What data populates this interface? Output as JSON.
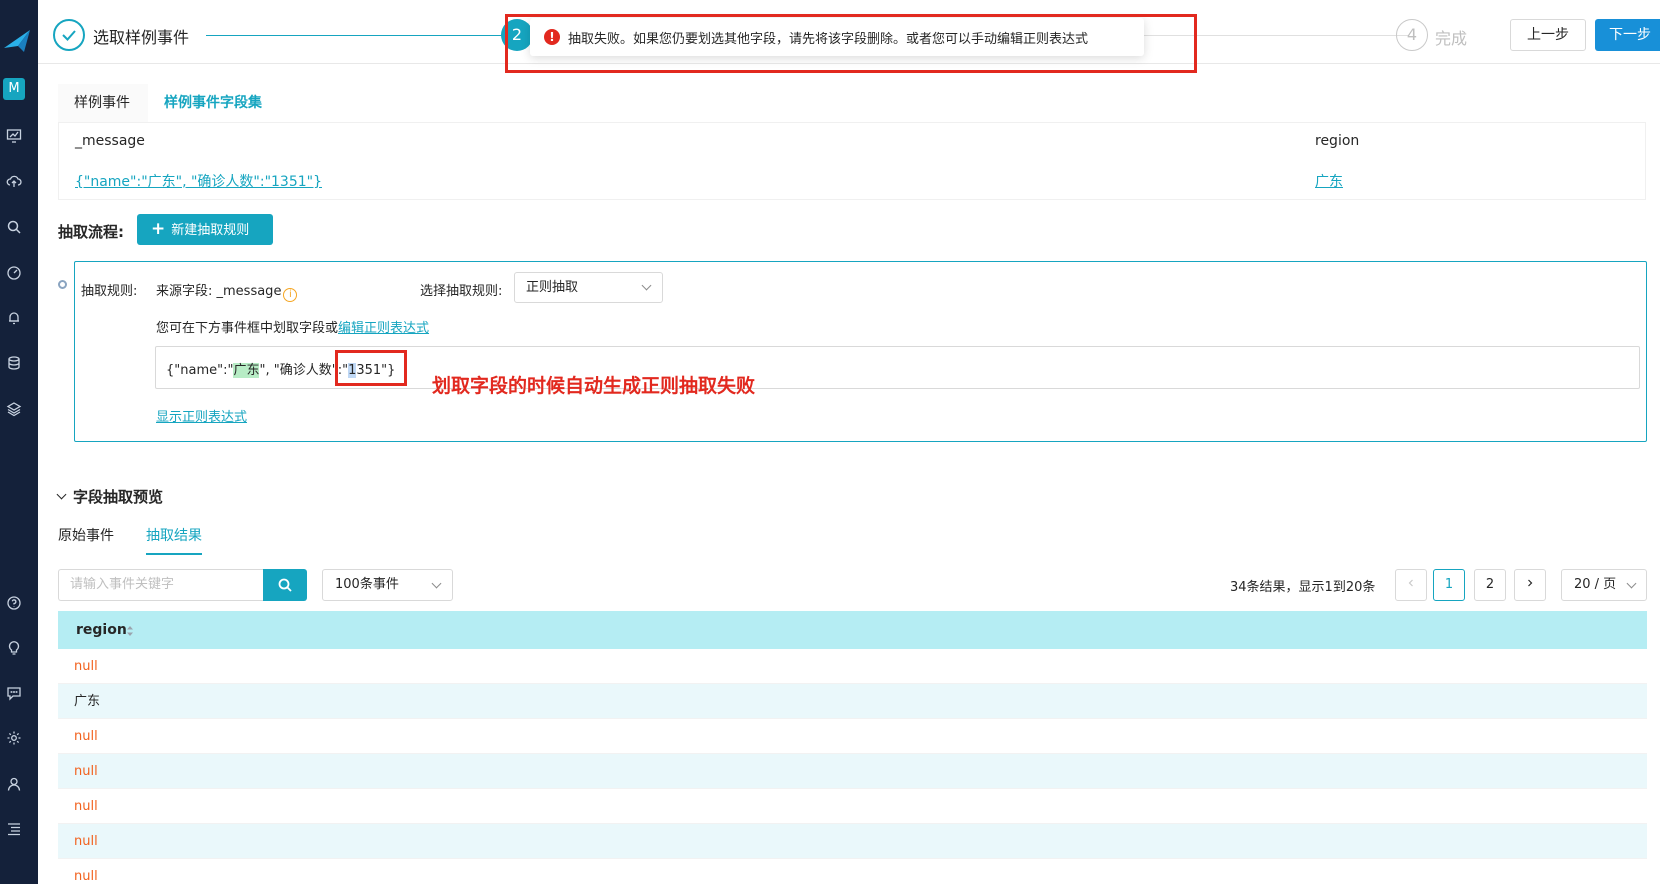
{
  "sidebar": {
    "avatar_letter": "M",
    "icons": [
      "dashboard-icon",
      "upload-cloud-icon",
      "search-icon",
      "gauge-icon",
      "bell-icon",
      "storage-icon",
      "layers-icon",
      "help-icon",
      "bulb-icon",
      "chat-icon",
      "gear-icon",
      "user-icon",
      "list-icon"
    ]
  },
  "steps": {
    "step1_label": "选取样例事件",
    "step2_number": "2",
    "step4_number": "4",
    "step4_label": "完成",
    "prev_button": "上一步",
    "next_button": "下一步"
  },
  "toast": {
    "icon": "!",
    "message": "抽取失败。如果您仍要划选其他字段，请先将该字段删除。或者您可以手动编辑正则表达式"
  },
  "source_tabs": [
    "样例事件",
    "样例事件字段集"
  ],
  "sample": {
    "col1_header": "_message",
    "col2_header": "region",
    "col1_value": "{\"name\":\"广东\", \"确诊人数\":\"1351\"}",
    "col2_value": "广东"
  },
  "flow": {
    "title": "抽取流程:",
    "new_rule_button": "新建抽取规则",
    "rule_label": "抽取规则:",
    "source_field": "来源字段: _message",
    "choose_rule_label": "选择抽取规则:",
    "rule_select_value": "正则抽取",
    "hint_text": "您可在下方事件框中划取字段或",
    "hint_link": "编辑正则表达式",
    "event_part1": "{\"name\":\"",
    "event_hl1": "广东",
    "event_part2": "\", \"确诊人数\":\"",
    "event_hl2": "1",
    "event_part3": "351\"}",
    "show_regex_link": "显示正则表达式",
    "annotation": "划取字段的时候自动生成正则抽取失败"
  },
  "preview": {
    "title": "字段抽取预览",
    "tabs": [
      "原始事件",
      "抽取结果"
    ],
    "search_placeholder": "请输入事件关键字",
    "count_select": "100条事件",
    "total_text": "34条结果，显示1到20条",
    "pages": [
      "1",
      "2"
    ],
    "page_size": "20 / 页"
  },
  "table": {
    "header": "region",
    "rows": [
      "null",
      "广东",
      "null",
      "null",
      "null",
      "null",
      "null"
    ]
  },
  "colors": {
    "accent": "#16a5c0",
    "error": "#e2291f",
    "null_text": "#f2611d",
    "header_bg": "#b5edf3",
    "sidebar_bg": "#14213a"
  }
}
